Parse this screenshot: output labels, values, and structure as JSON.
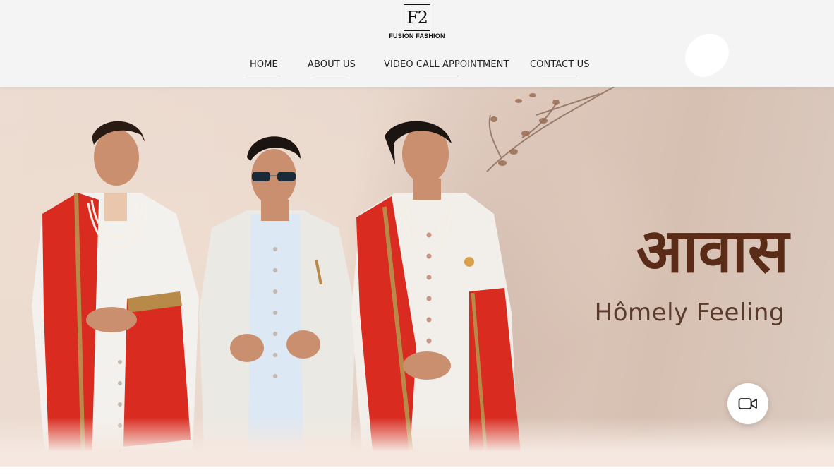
{
  "logo": {
    "mark": "F2",
    "name": "FUSION FASHION"
  },
  "nav": {
    "items": [
      {
        "label": "HOME"
      },
      {
        "label": "ABOUT US"
      },
      {
        "label": "VIDEO CALL APPOINTMENT"
      },
      {
        "label": "CONTACT US"
      }
    ]
  },
  "hero": {
    "brand_word": "आवास",
    "tagline": "Hômely Feeling",
    "image_icon": "three-men-in-sherwani-photo"
  },
  "video_call": {
    "icon": "video-camera-icon"
  },
  "colors": {
    "header_bg": "#f4f4f4",
    "brand_brown": "#5a2b17",
    "tagline_brown": "#5a3a2b",
    "hero_beige": "#e9d8cd",
    "accent_red": "#d92b1f"
  }
}
